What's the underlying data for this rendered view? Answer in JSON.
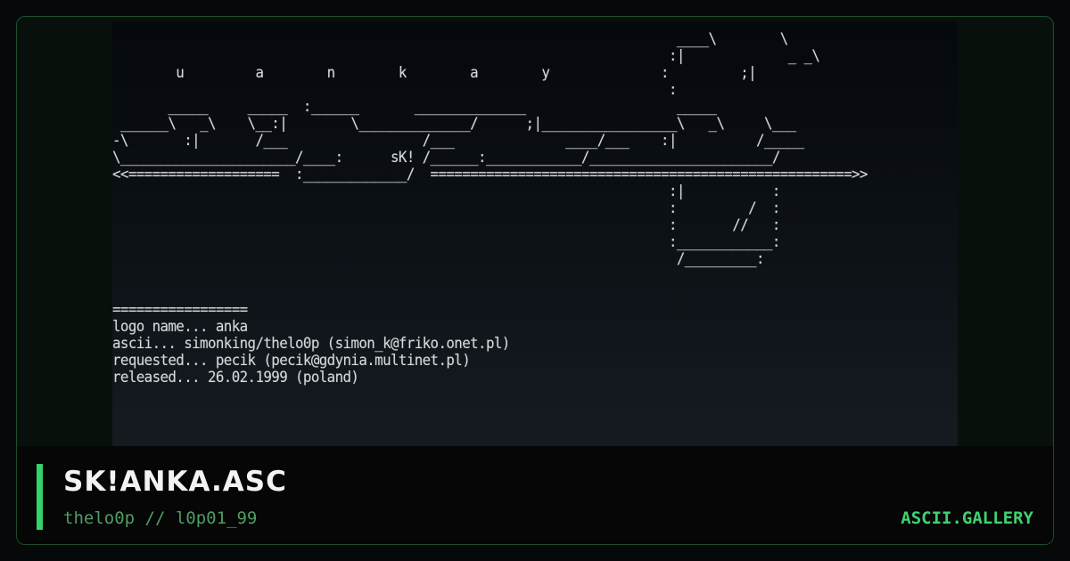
{
  "art": {
    "text": "                                                                       ____\\        \\\n                                                                      :|             _ _\\\n        u         a        n        k        a        y              :         ;|\n                                                                      :\n       _____     _____  :______       ______________                   _____\n ______\\   _\\    \\__:|        \\______________/      ;|_________________\\   _\\     \\___\n-\\       :|       /___                 /___              ____/___    :|          /_____\n\\______________________/____:      sK! /______:____________/_______________________/\n<<===================  :_____________/  =====================================================>>\n                                                                      :|           :\n                                                                      :         /  :\n                                                                      :       //   :\n                                                                      :____________:\n                                                                       /_________:\n\n\n=================\nlogo name... anka\nascii... simonking/thelo0p (simon_k@friko.onet.pl)\nrequested... pecik (pecik@gdynia.multinet.pl)\nreleased... 26.02.1999 (poland)"
  },
  "footer": {
    "title": "SK!ANKA.ASC",
    "subtitle": "thelo0p // l0p01_99",
    "brand": "ASCII.GALLERY"
  },
  "colors": {
    "accent": "#35d16a",
    "brand": "#3ed26f",
    "subtitle": "#4f9c64",
    "border": "#1f4a2c"
  }
}
